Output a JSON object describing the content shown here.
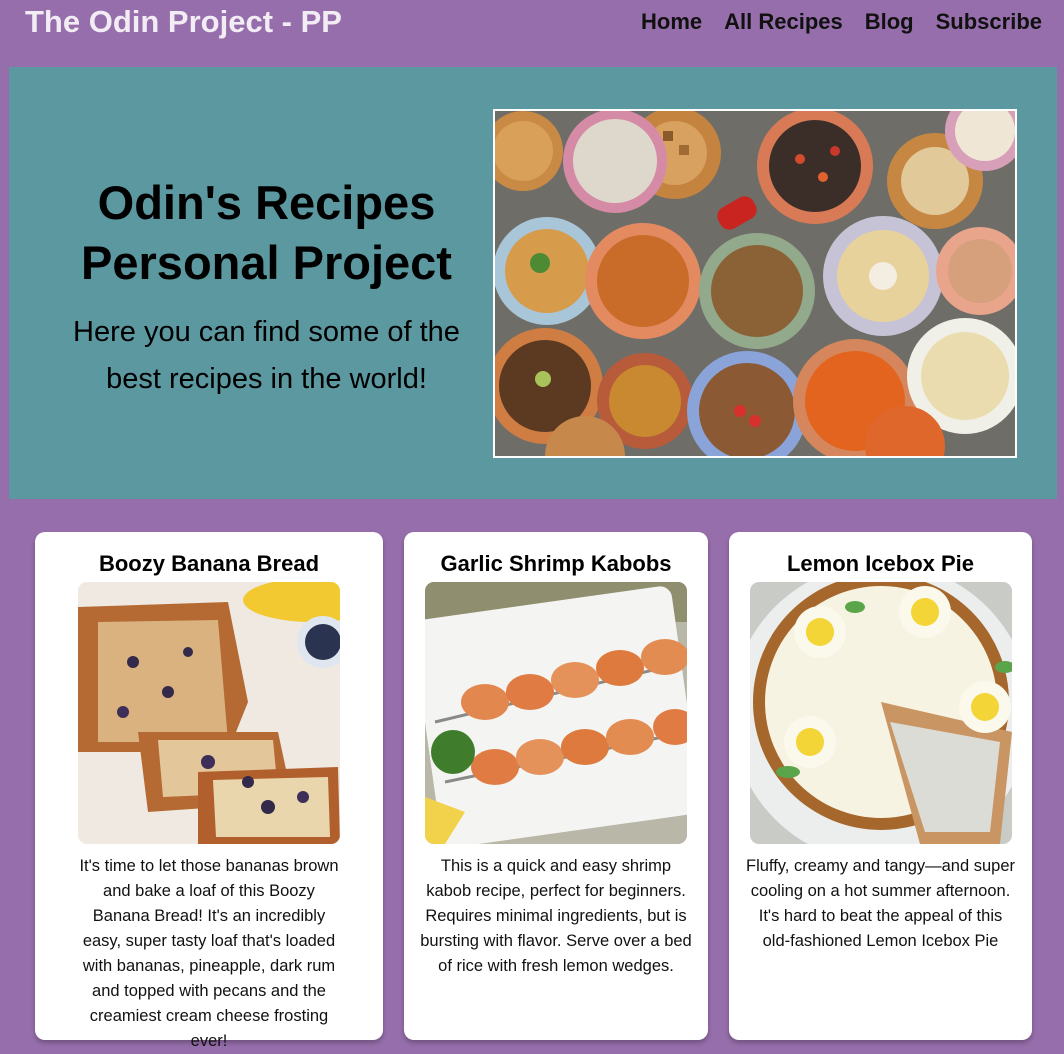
{
  "header": {
    "brand": "The Odin Project - PP",
    "nav": [
      "Home",
      "All Recipes",
      "Blog",
      "Subscribe"
    ]
  },
  "hero": {
    "title_line1": "Odin's Recipes",
    "title_line2": "Personal Project",
    "subtitle": "Here you can find some of the best recipes in the world!",
    "image_label": "soup-bowls-photo"
  },
  "cards": [
    {
      "title": "Boozy Banana Bread",
      "image_label": "banana-bread-photo",
      "description": "It's time to let those bananas brown and bake a loaf of this Boozy Banana Bread! It's an incredibly easy, super tasty loaf that's loaded with bananas, pineapple, dark rum and topped with pecans and the creamiest cream cheese frosting ever!"
    },
    {
      "title": "Garlic Shrimp Kabobs",
      "image_label": "shrimp-kabobs-photo",
      "description": "This is a quick and easy shrimp kabob recipe, perfect for beginners. Requires minimal ingredients, but is bursting with flavor. Serve over a bed of rice with fresh lemon wedges."
    },
    {
      "title": "Lemon Icebox Pie",
      "image_label": "lemon-pie-photo",
      "description": "Fluffy, creamy and tangy—and super cooling on a hot summer afternoon. It's hard to beat the appeal of this old-fashioned Lemon Icebox Pie"
    }
  ],
  "colors": {
    "page_bg": "#966eab",
    "hero_bg": "#5b98a0",
    "card_bg": "#ffffff",
    "brand_text": "#f2ecf4"
  }
}
